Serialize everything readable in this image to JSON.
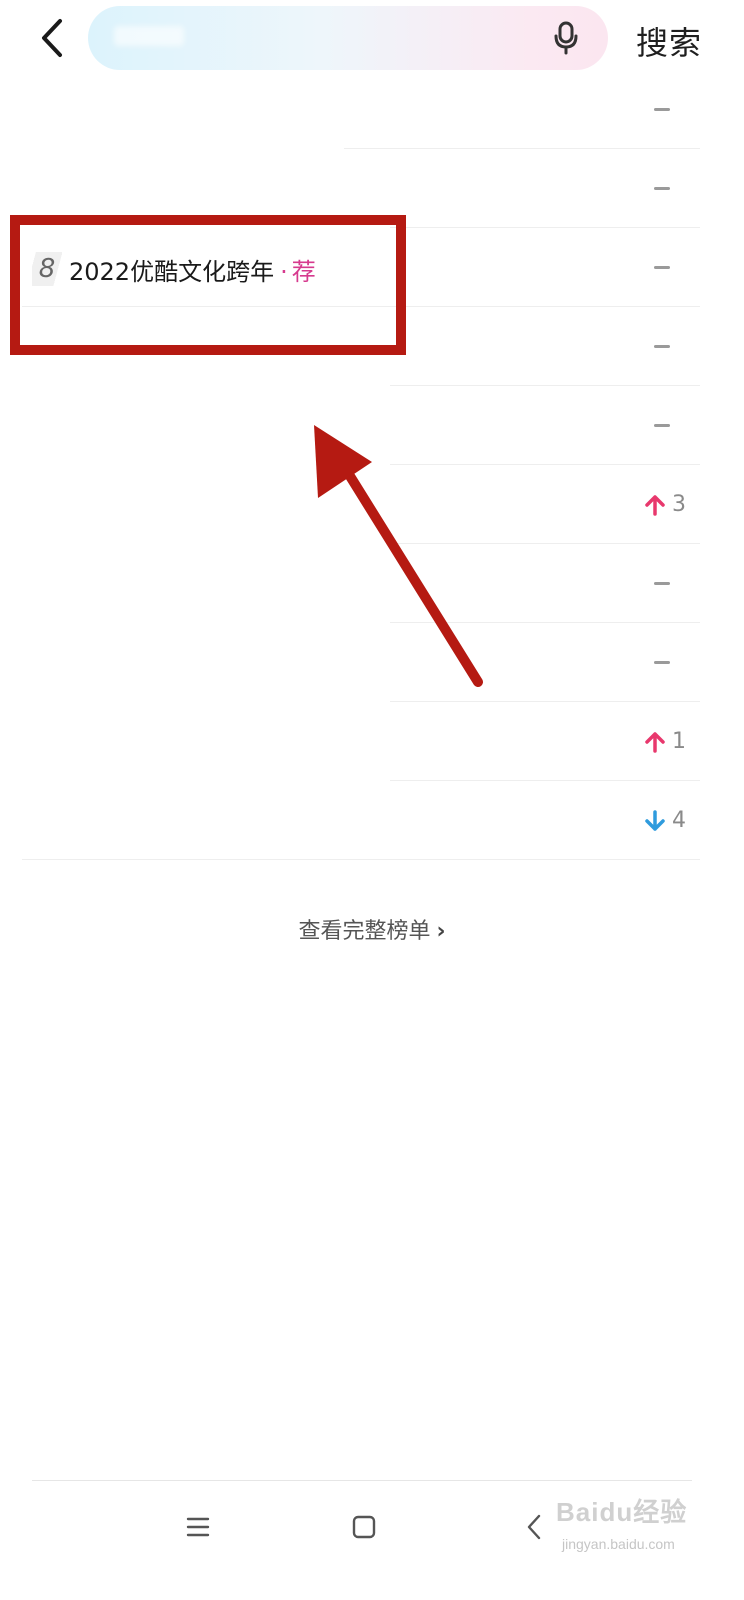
{
  "header": {
    "search_button": "搜索",
    "back_icon": "chevron-left-icon",
    "mic_icon": "microphone-icon"
  },
  "ranking": {
    "highlighted_item": {
      "rank": "8",
      "title": "2022优酷文化跨年",
      "separator": "·",
      "tag": "荐"
    },
    "trends": [
      {
        "direction": "same",
        "count": ""
      },
      {
        "direction": "same",
        "count": ""
      },
      {
        "direction": "same",
        "count": ""
      },
      {
        "direction": "same",
        "count": ""
      },
      {
        "direction": "same",
        "count": ""
      },
      {
        "direction": "up",
        "count": "3"
      },
      {
        "direction": "same",
        "count": ""
      },
      {
        "direction": "same",
        "count": ""
      },
      {
        "direction": "up",
        "count": "1"
      },
      {
        "direction": "down",
        "count": "4"
      }
    ],
    "up_color": "#e8386d",
    "down_color": "#2f9bdd"
  },
  "footer_link": {
    "label": "查看完整榜单",
    "chevron": "›"
  },
  "bottom_nav": {
    "menu_icon": "menu-icon",
    "home_icon": "home-square-icon",
    "back_icon": "back-chevron-icon"
  },
  "watermark": {
    "text": "Baidu经验",
    "sub": "jingyan.baidu.com"
  },
  "annotation_color": "#b51a12"
}
